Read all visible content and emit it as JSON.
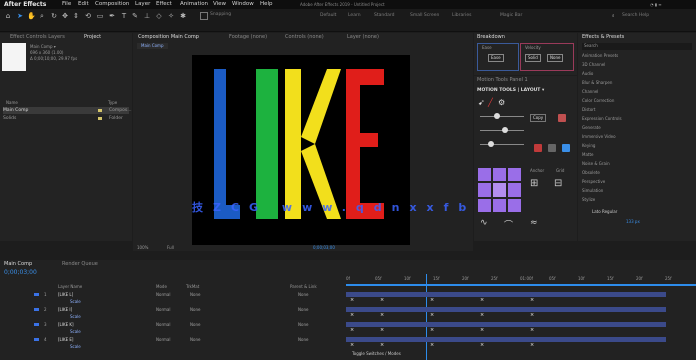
{
  "app": {
    "name": "After Effects"
  },
  "menu": {
    "items": [
      "File",
      "Edit",
      "Composition",
      "Layer",
      "Effect",
      "Animation",
      "View",
      "Window",
      "Help"
    ],
    "center_title": "Adobe After Effects 2019 - Untitled Project"
  },
  "toolbar": {
    "snapping_label": "Snapping",
    "workspaces": [
      "Default",
      "Learn",
      "Standard",
      "Small Screen",
      "Libraries",
      "Magic Bar"
    ],
    "search_placeholder": "Search Help"
  },
  "project": {
    "tabs": [
      "Effect Controls Layers",
      "Project"
    ],
    "thumb_info": [
      "Main Comp ▾",
      "696 x 360 (1.00)",
      "Δ 0;00;10;00, 29.97 fps"
    ],
    "col_name": "Name",
    "col_type": "Type",
    "items": [
      {
        "name": "Main Comp",
        "type": "Compos..."
      },
      {
        "name": "Solids",
        "type": "Folder"
      }
    ]
  },
  "viewer": {
    "tab": "Composition Main Comp",
    "header_items": [
      "Footage (none)",
      "Controls (none)",
      "Layer (none)"
    ],
    "comp_label": "Main Comp",
    "zoom": "100%",
    "quality": "Full",
    "timecode": "0;00;03;00",
    "watermark": "技ZCG www.qdnxxfb.com",
    "letters": [
      {
        "char": "L",
        "color": "#1b5bc4"
      },
      {
        "char": "I",
        "color": "#1db23f"
      },
      {
        "char": "K",
        "color": "#f2df1c"
      },
      {
        "char": "E",
        "color": "#e01e1a"
      }
    ]
  },
  "effects": {
    "title": "Breakdown",
    "ease_label": "Ease",
    "velocity_label": "Velocity",
    "solid_label": "Solid",
    "none_label": "None"
  },
  "motion": {
    "title": "MOTION TOOLS | LAYOUT ▾",
    "header": "Motion Tools Panel 1",
    "copy_label": "Copy",
    "paste_label": "Paste",
    "anchor_label": "Anchor",
    "grid_label": "Grid"
  },
  "library": {
    "tab": "Effects & Presets",
    "search_placeholder": "Search",
    "items": [
      "Animation Presets",
      "3D Channel",
      "Audio",
      "Blur & Sharpen",
      "Channel",
      "Color Correction",
      "Distort",
      "Expression Controls",
      "Generate",
      "Immersive Video",
      "Keying",
      "Matte",
      "Noise & Grain",
      "Obsolete",
      "Perspective",
      "Simulation",
      "Stylize"
    ],
    "font_name": "Lato Regular",
    "font_size": "133 px"
  },
  "timeline": {
    "tab": "Main Comp",
    "tab2": "Render Queue",
    "timecode": "0;00;03;00",
    "col_layer": "Layer Name",
    "col_mode": "Mode",
    "col_trkmat": "TrkMat",
    "col_parent": "Parent & Link",
    "ruler": [
      "0f",
      "05f",
      "10f",
      "15f",
      "20f",
      "25f",
      "01:00f",
      "05f",
      "10f",
      "15f",
      "20f",
      "25f"
    ],
    "layers": [
      {
        "num": "1",
        "name": "[LIKE L]",
        "sub": "Scale",
        "mode": "Normal",
        "trk": "None",
        "parent": "None"
      },
      {
        "num": "2",
        "name": "[LIKE I]",
        "sub": "Scale",
        "mode": "Normal",
        "trk": "None",
        "parent": "None"
      },
      {
        "num": "3",
        "name": "[LIKE K]",
        "sub": "Scale",
        "mode": "Normal",
        "trk": "None",
        "parent": "None"
      },
      {
        "num": "4",
        "name": "[LIKE E]",
        "sub": "Scale",
        "mode": "Normal",
        "trk": "None",
        "parent": "None"
      }
    ],
    "footer_label": "Toggle Switches / Modes"
  },
  "colors": {
    "accent": "#2d8ceb",
    "canvas_bg": "#000000",
    "panel_bg": "#232323"
  }
}
